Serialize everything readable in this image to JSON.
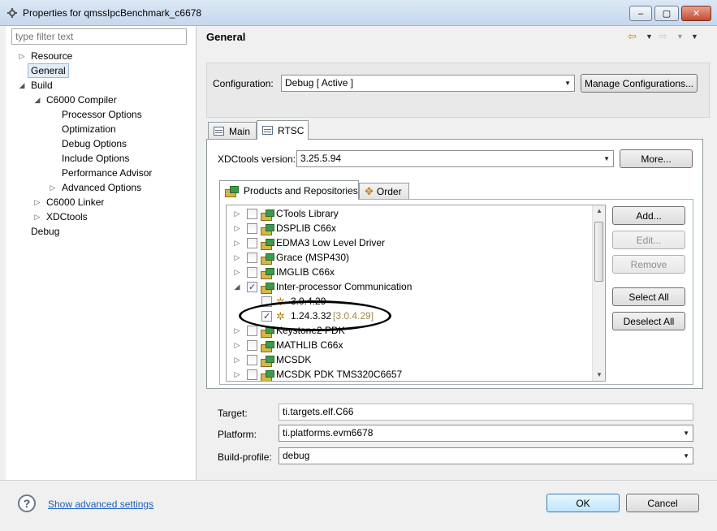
{
  "window": {
    "title": "Properties for qmssIpcBenchmark_c6678",
    "minimize": "–",
    "maximize": "▢",
    "close": "✕"
  },
  "filter": {
    "placeholder": "type filter text"
  },
  "tree": {
    "resource": "Resource",
    "general": "General",
    "build": "Build",
    "c6000_compiler": "C6000 Compiler",
    "processor_options": "Processor Options",
    "optimization": "Optimization",
    "debug_options": "Debug Options",
    "include_options": "Include Options",
    "performance_advisor": "Performance Advisor",
    "advanced_options": "Advanced Options",
    "c6000_linker": "C6000 Linker",
    "xdctools": "XDCtools",
    "debug": "Debug"
  },
  "header": {
    "title": "General"
  },
  "configuration": {
    "label": "Configuration:",
    "value": "Debug  [ Active ]",
    "manage_label": "Manage Configurations..."
  },
  "tabs": {
    "main": "Main",
    "rtsc": "RTSC"
  },
  "xdctools": {
    "label": "XDCtools version:",
    "value": "3.25.5.94",
    "more_label": "More..."
  },
  "inner_tabs": {
    "products": "Products and Repositories",
    "order": "Order"
  },
  "products": [
    {
      "label": "CTools Library",
      "checked": false
    },
    {
      "label": "DSPLIB C66x",
      "checked": false
    },
    {
      "label": "EDMA3 Low Level Driver",
      "checked": false
    },
    {
      "label": "Grace (MSP430)",
      "checked": false
    },
    {
      "label": "IMGLIB C66x",
      "checked": false
    },
    {
      "label": "Inter-processor Communication",
      "checked": true
    },
    {
      "label": "3.0.4.29",
      "checked": false
    },
    {
      "label": "1.24.3.32",
      "note": "[3.0.4.29]",
      "checked": true
    },
    {
      "label": "Keystone2 PDK",
      "checked": false
    },
    {
      "label": "MATHLIB C66x",
      "checked": false
    },
    {
      "label": "MCSDK",
      "checked": false
    },
    {
      "label": "MCSDK PDK TMS320C6657",
      "checked": false
    }
  ],
  "list_buttons": {
    "add": "Add...",
    "edit": "Edit...",
    "remove": "Remove",
    "select_all": "Select All",
    "deselect_all": "Deselect All"
  },
  "target": {
    "label": "Target:",
    "value": "ti.targets.elf.C66"
  },
  "platform": {
    "label": "Platform:",
    "value": "ti.platforms.evm6678"
  },
  "build_profile": {
    "label": "Build-profile:",
    "value": "debug"
  },
  "footer": {
    "help": "?",
    "advanced_link": "Show advanced settings",
    "ok": "OK",
    "cancel": "Cancel"
  }
}
